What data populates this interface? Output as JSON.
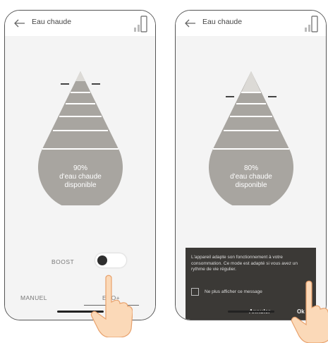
{
  "screens": [
    {
      "title": "Eau chaude",
      "drop": {
        "percent_text": "90%",
        "line1": "d'eau chaude",
        "line2": "disponible",
        "level_fraction": 0.9
      },
      "boost_label": "BOOST",
      "boost_on": false,
      "tabs": {
        "manual": "MANUEL",
        "eco": "ECO+"
      }
    },
    {
      "title": "Eau chaude",
      "drop": {
        "percent_text": "80%",
        "line1": "d'eau chaude",
        "line2": "disponible",
        "level_fraction": 0.8
      },
      "dialog": {
        "message": "L'appareil adapte son fonctionnement à votre consommation. Ce mode est adapté si vous avez un rythme de vie régulier.",
        "checkbox_label": "Ne plus afficher ce message",
        "cancel": "Annuler",
        "ok": "Ok"
      }
    }
  ],
  "colors": {
    "drop_fill": "#a8a5a0",
    "drop_band": "#8d8a85",
    "drop_empty": "#dcdad6",
    "dialog_bg": "#3b3936"
  },
  "icons": [
    "back-arrow-icon",
    "battery-icon",
    "water-drop-icon",
    "hand-pointer-icon"
  ]
}
